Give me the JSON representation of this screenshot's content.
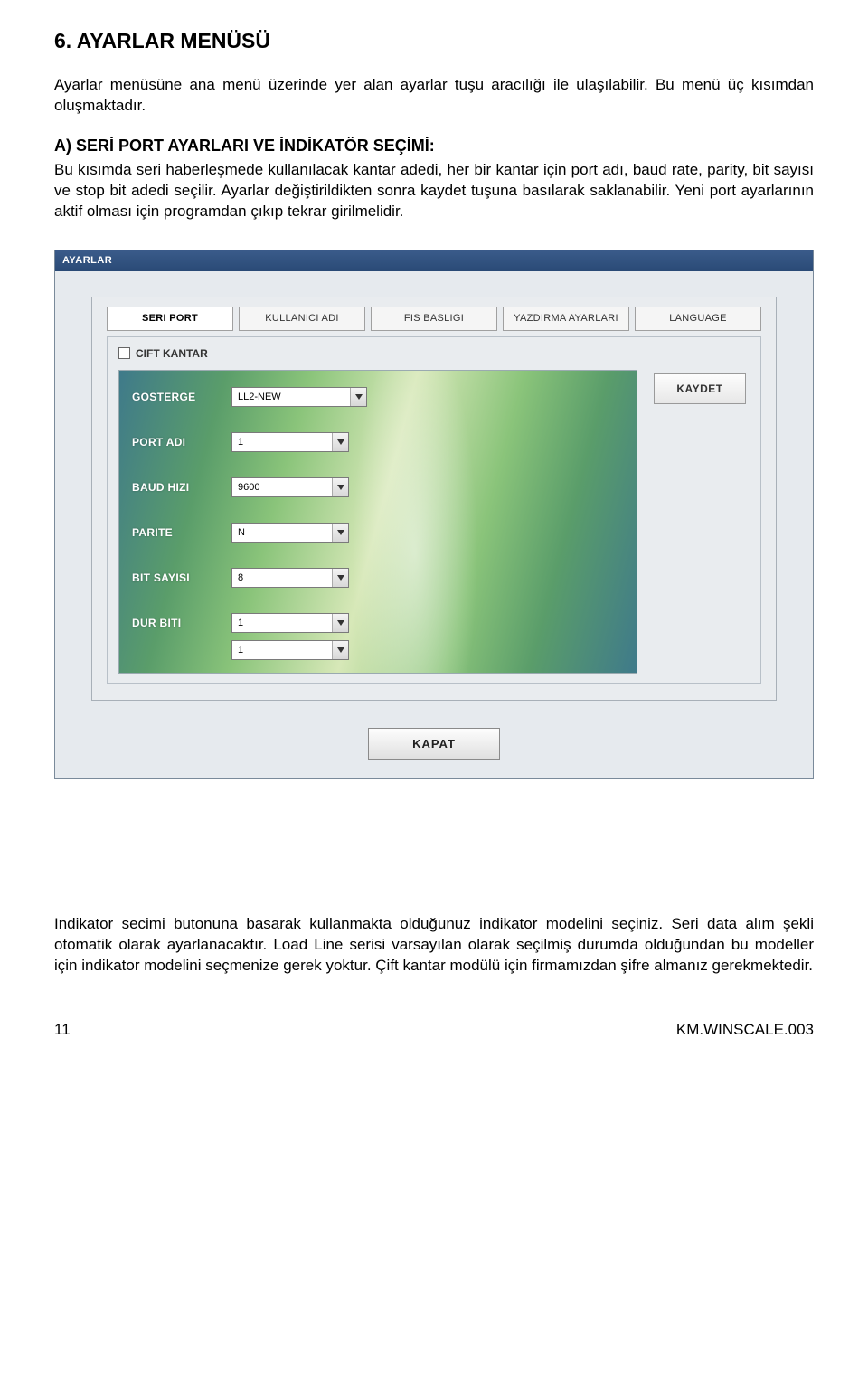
{
  "doc": {
    "heading": "6. AYARLAR MENÜSÜ",
    "intro": "Ayarlar menüsüne ana menü üzerinde yer alan ayarlar tuşu aracılığı ile ulaşılabilir. Bu menü üç kısımdan oluşmaktadır.",
    "subheading": "A) SERİ PORT AYARLARI VE İNDİKATÖR SEÇİMİ:",
    "body1": "Bu kısımda seri haberleşmede kullanılacak kantar adedi, her bir kantar için port adı, baud rate, parity, bit sayısı ve stop bit adedi seçilir. Ayarlar değiştirildikten sonra kaydet tuşuna basılarak saklanabilir. Yeni port ayarlarının aktif olması için programdan çıkıp tekrar girilmelidir.",
    "body2": "Indikator secimi butonuna basarak kullanmakta olduğunuz indikator modelini seçiniz. Seri data alım şekli otomatik olarak ayarlanacaktır. Load Line serisi varsayılan olarak seçilmiş durumda olduğundan bu modeller için indikator modelini seçmenize gerek yoktur. Çift kantar modülü için firmamızdan şifre almanız gerekmektedir.",
    "page_num": "11",
    "doc_code": "KM.WINSCALE.003"
  },
  "app": {
    "title": "AYARLAR",
    "tabs": {
      "seri_port": "SERI PORT",
      "kullanici_adi": "KULLANICI ADI",
      "fis_basligi": "FIS BASLIGI",
      "yazdirma": "YAZDIRMA AYARLARI",
      "language": "LANGUAGE"
    },
    "checkbox_label": "CIFT KANTAR",
    "labels": {
      "gosterge": "GOSTERGE",
      "port_adi": "PORT ADI",
      "baud_hizi": "BAUD HIZI",
      "parite": "PARITE",
      "bit_sayisi": "BIT SAYISI",
      "dur": "DUR BITI"
    },
    "values": {
      "gosterge": "LL2-NEW",
      "port_adi": "1",
      "baud_hizi": "9600",
      "parite": "N",
      "bit_sayisi": "8",
      "dur": "1",
      "extra": "1"
    },
    "buttons": {
      "kaydet": "KAYDET",
      "kapat": "KAPAT"
    }
  }
}
